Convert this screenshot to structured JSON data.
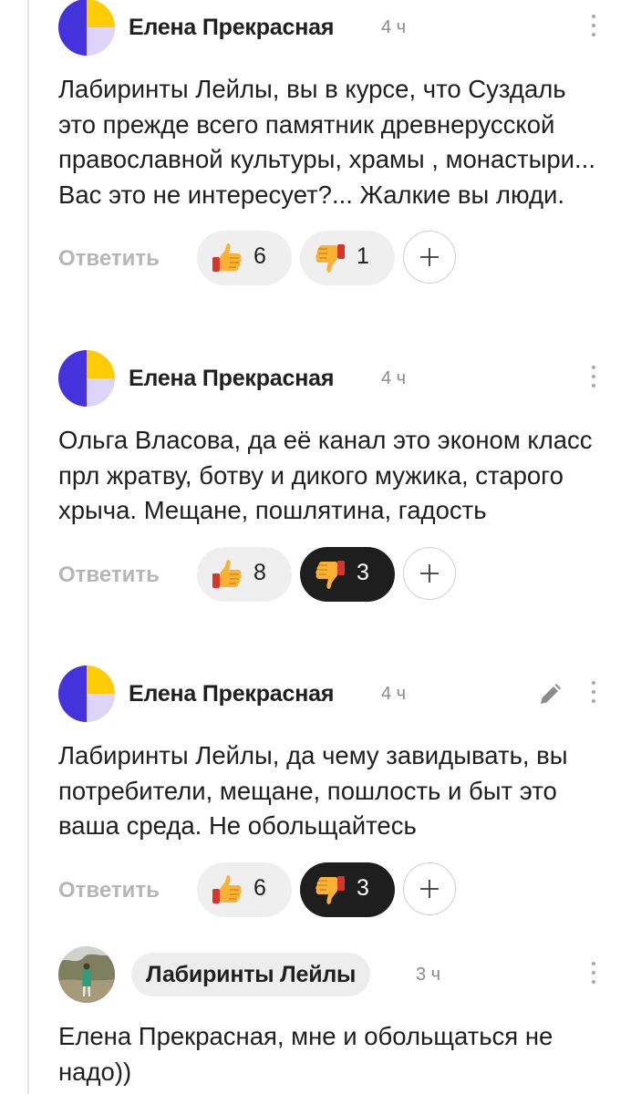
{
  "comments": [
    {
      "author": "Елена Прекрасная",
      "time": "4 ч",
      "text": "Лабиринты Лейлы, вы в курсе, что Суздаль это прежде всего памятник древнерусской православной культуры, храмы , монастыри... Вас это не интересует?... Жалкие вы люди.",
      "reply_label": "Ответить",
      "likes": "6",
      "dislikes": "1",
      "disliked": false
    },
    {
      "author": "Елена Прекрасная",
      "time": "4 ч",
      "text": "Ольга Власова, да её канал это эконом класс прл жратву, ботву и дикого мужика, старого хрыча. Мещане, пошлятина, гадость",
      "reply_label": "Ответить",
      "likes": "8",
      "dislikes": "3",
      "disliked": true
    },
    {
      "author": "Елена Прекрасная",
      "time": "4 ч",
      "text": "Лабиринты Лейлы, да чему завидывать, вы потребители, мещане, пошлость и быт это ваша среда. Не обольщайтесь",
      "reply_label": "Ответить",
      "likes": "6",
      "dislikes": "3",
      "disliked": true,
      "editable": true
    },
    {
      "author": "Лабиринты Лейлы",
      "time": "3 ч",
      "text": "Елена Прекрасная, мне и обольщаться не надо))"
    }
  ],
  "icons": {
    "avatar_default": "avatar-icon",
    "like": "thumbs-up-icon",
    "dislike": "thumbs-down-icon",
    "add_reaction": "plus-icon",
    "menu": "more-vertical-icon",
    "edit": "pencil-icon"
  },
  "colors": {
    "avatar_yellow": "#FFCC00",
    "avatar_blue": "#4433DD",
    "avatar_lavender": "#DDD5F8",
    "active_reaction_bg": "#1E1E1E",
    "reaction_bg": "#EFEFEF",
    "reply_text": "#B6B6B6"
  }
}
